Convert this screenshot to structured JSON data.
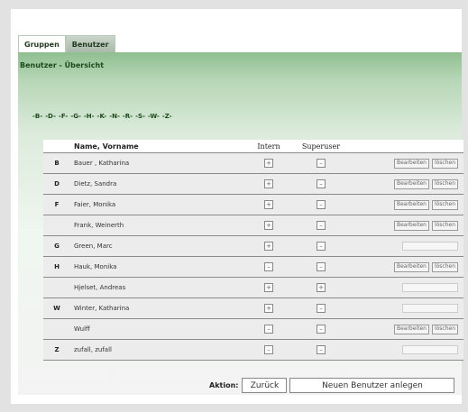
{
  "tabs": [
    {
      "label": "Gruppen"
    },
    {
      "label": "Benutzer"
    }
  ],
  "page_title": "Benutzer - Übersicht",
  "alphabet": [
    "-B-",
    "-D-",
    "-F-",
    "-G-",
    "-H-",
    "-K-",
    "-N-",
    "-R-",
    "-S-",
    "-W-",
    "-Z-"
  ],
  "table": {
    "col_name": "Name, Vorname",
    "col_intern": "Intern",
    "col_superuser": "Superuser",
    "edit_label": "Bearbeiten",
    "delete_label": "löschen",
    "rows": [
      {
        "letter": "B",
        "name": "Bauer , Katharina",
        "intern": true,
        "superuser": false,
        "actions": true
      },
      {
        "letter": "D",
        "name": "Dietz, Sandra",
        "intern": true,
        "superuser": false,
        "actions": true
      },
      {
        "letter": "F",
        "name": "Faier, Monika",
        "intern": true,
        "superuser": false,
        "actions": true
      },
      {
        "letter": "",
        "name": "Frank, Weinerth",
        "intern": true,
        "superuser": false,
        "actions": true
      },
      {
        "letter": "G",
        "name": "Green, Marc",
        "intern": true,
        "superuser": false,
        "actions": false
      },
      {
        "letter": "H",
        "name": "Hauk, Monika",
        "intern": false,
        "superuser": false,
        "actions": true
      },
      {
        "letter": "",
        "name": "Hjelset, Andreas",
        "intern": true,
        "superuser": true,
        "actions": false
      },
      {
        "letter": "W",
        "name": "Winter, Katharina",
        "intern": true,
        "superuser": false,
        "actions": false
      },
      {
        "letter": "",
        "name": "Wulff",
        "intern": false,
        "superuser": false,
        "actions": true
      },
      {
        "letter": "Z",
        "name": "zufall, zufall",
        "intern": false,
        "superuser": false,
        "actions": false
      }
    ]
  },
  "action_bar": {
    "label": "Aktion:",
    "back_label": "Zurück",
    "new_user_label": "Neuen Benutzer anlegen"
  }
}
